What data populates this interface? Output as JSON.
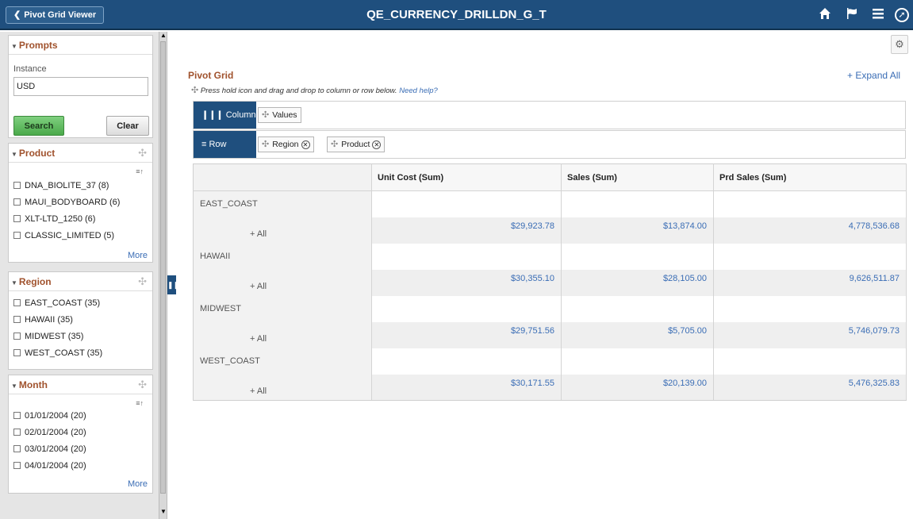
{
  "header": {
    "back_label": "Pivot Grid Viewer",
    "title": "QE_CURRENCY_DRILLDN_G_T",
    "icons": [
      "home-icon",
      "flag-icon",
      "menu-icon",
      "navbar-icon"
    ]
  },
  "prompts": {
    "title": "Prompts",
    "instance_label": "Instance",
    "instance_value": "USD",
    "search_label": "Search",
    "clear_label": "Clear"
  },
  "facets": {
    "product": {
      "title": "Product",
      "items": [
        "DNA_BIOLITE_37 (8)",
        "MAUI_BODYBOARD (6)",
        "XLT-LTD_1250 (6)",
        "CLASSIC_LIMITED (5)"
      ],
      "more": "More"
    },
    "region": {
      "title": "Region",
      "items": [
        "EAST_COAST (35)",
        "HAWAII (35)",
        "MIDWEST (35)",
        "WEST_COAST (35)"
      ]
    },
    "month": {
      "title": "Month",
      "items": [
        "01/01/2004 (20)",
        "02/01/2004 (20)",
        "03/01/2004 (20)",
        "04/01/2004 (20)"
      ],
      "more": "More"
    }
  },
  "pivot": {
    "title": "Pivot Grid",
    "expand_all": "+ Expand All",
    "hint": "Press hold icon and drag and drop to column or row below.",
    "help_link": "Need help?",
    "column_label": "Column",
    "row_label": "Row",
    "column_chips": [
      "Values"
    ],
    "row_chips": [
      "Region",
      "Product"
    ],
    "headers": [
      "",
      "Unit Cost (Sum)",
      "Sales (Sum)",
      "Prd Sales (Sum)"
    ],
    "sub_label": "+ All",
    "regions": [
      {
        "name": "EAST_COAST",
        "values": [
          "$29,923.78",
          "$13,874.00",
          "4,778,536.68"
        ]
      },
      {
        "name": "HAWAII",
        "values": [
          "$30,355.10",
          "$28,105.00",
          "9,626,511.87"
        ]
      },
      {
        "name": "MIDWEST",
        "values": [
          "$29,751.56",
          "$5,705.00",
          "5,746,079.73"
        ]
      },
      {
        "name": "WEST_COAST",
        "values": [
          "$30,171.55",
          "$20,139.00",
          "5,476,325.83"
        ]
      }
    ]
  },
  "colors": {
    "header_bg": "#1f4f7e",
    "accent_title": "#a0522d",
    "link": "#3a6db5",
    "search_green": "#4aa94a"
  }
}
